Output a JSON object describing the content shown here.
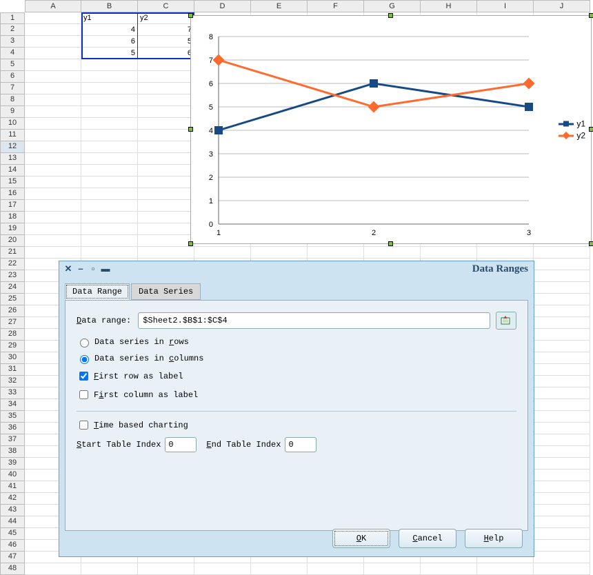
{
  "columns": [
    "A",
    "B",
    "C",
    "D",
    "E",
    "F",
    "G",
    "H",
    "I",
    "J"
  ],
  "row_count": 48,
  "selected_row": 12,
  "cell_data": {
    "B1": "y1",
    "C1": "y2",
    "B2": "4",
    "C2": "7",
    "B3": "6",
    "C3": "5",
    "B4": "5",
    "C4": "6"
  },
  "selection_range": "B1:C4",
  "chart_data": {
    "type": "line",
    "x": [
      1,
      2,
      3
    ],
    "series": [
      {
        "name": "y1",
        "values": [
          4,
          6,
          5
        ],
        "color": "#174a85",
        "marker": "square"
      },
      {
        "name": "y2",
        "values": [
          7,
          5,
          6
        ],
        "color": "#ff6a2f",
        "marker": "diamond"
      }
    ],
    "ylim": [
      0,
      8
    ],
    "ylabel": "",
    "xlabel": "",
    "x_tick_labels": [
      "1",
      "2",
      "3"
    ],
    "y_tick_labels": [
      "0",
      "1",
      "2",
      "3",
      "4",
      "5",
      "6",
      "7",
      "8"
    ]
  },
  "dialog": {
    "title": "Data Ranges",
    "tabs": [
      "Data Range",
      "Data Series"
    ],
    "active_tab": 0,
    "data_range_label": "Data range:",
    "data_range_value": "$Sheet2.$B$1:$C$4",
    "opt_rows": "Data series in rows",
    "opt_cols": "Data series in columns",
    "opt_cols_selected": true,
    "chk_first_row": "First row as label",
    "chk_first_row_checked": true,
    "chk_first_col": "First column as label",
    "chk_first_col_checked": false,
    "chk_time": "Time based charting",
    "chk_time_checked": false,
    "start_idx_label": "Start Table Index",
    "start_idx_value": "0",
    "end_idx_label": "End Table Index",
    "end_idx_value": "0",
    "btn_ok": "OK",
    "btn_cancel": "Cancel",
    "btn_help": "Help"
  }
}
